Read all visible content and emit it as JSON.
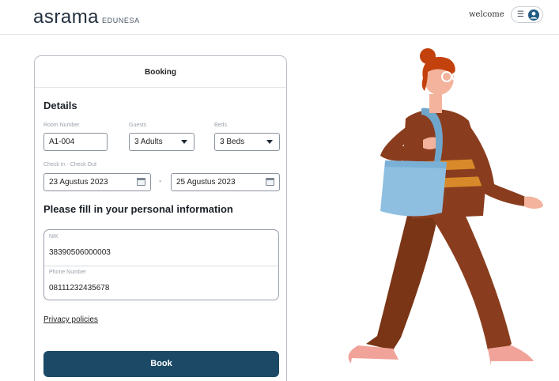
{
  "header": {
    "brand_main": "asrama",
    "brand_sub": "EDUNESA",
    "welcome": "welcome"
  },
  "card": {
    "title": "Booking",
    "details_title": "Details",
    "room_number": {
      "label": "Room Number",
      "value": "A1-004"
    },
    "guests": {
      "label": "Guests",
      "value": "3 Adults"
    },
    "beds": {
      "label": "Beds",
      "value": "3 Beds"
    },
    "dates": {
      "label": "Check In - Check Out",
      "check_in": "23 Agustus 2023",
      "separator": "-",
      "check_out": "25 Agustus 2023"
    },
    "personal_title": "Please fill in your personal information",
    "nik": {
      "label": "NIK",
      "value": "38390506000003"
    },
    "phone": {
      "label": "Phone Number",
      "value": "08111232435678"
    },
    "privacy_link": "Privacy policies",
    "book_button": "Book"
  },
  "colors": {
    "primary": "#1c4a66",
    "bag": "#8fbfe0",
    "sweater": "#8a3d1e",
    "hair": "#c2410c"
  },
  "icons": [
    "menu-icon",
    "user-avatar-icon",
    "chevron-down-icon",
    "calendar-icon"
  ]
}
